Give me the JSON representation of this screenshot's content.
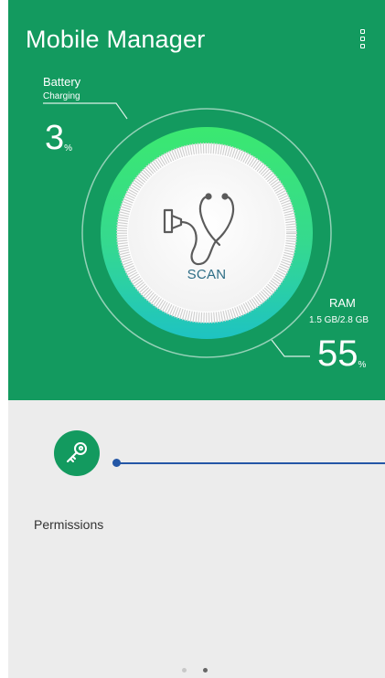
{
  "app": {
    "title": "Mobile Manager"
  },
  "battery": {
    "label": "Battery",
    "status": "Charging",
    "value": "3",
    "unit": "%"
  },
  "ram": {
    "label": "RAM",
    "usage": "1.5 GB/2.8 GB",
    "value": "55",
    "unit": "%"
  },
  "scan": {
    "label": "SCAN"
  },
  "tiles": [
    {
      "label": "Permissions",
      "icon": "key-icon"
    }
  ],
  "pager": {
    "pages": 2,
    "active_index": 1
  },
  "colors": {
    "brand_green": "#139A5F",
    "ring_green": "#39E06A",
    "ring_teal": "#23C9B8",
    "scan_text": "#2E6E86",
    "pointer_blue": "#2457A6",
    "content_bg": "#ECECEC"
  }
}
